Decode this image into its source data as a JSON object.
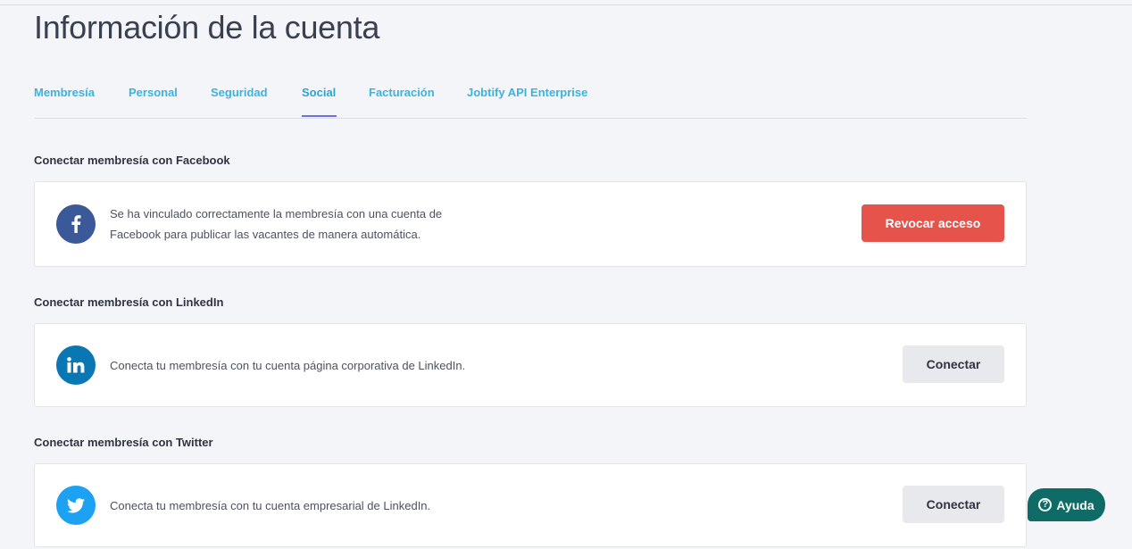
{
  "page": {
    "title": "Información de la cuenta"
  },
  "tabs": [
    {
      "label": "Membresía",
      "active": false
    },
    {
      "label": "Personal",
      "active": false
    },
    {
      "label": "Seguridad",
      "active": false
    },
    {
      "label": "Social",
      "active": true
    },
    {
      "label": "Facturación",
      "active": false
    },
    {
      "label": "Jobtify API Enterprise",
      "active": false
    }
  ],
  "sections": {
    "facebook": {
      "heading": "Conectar membresía con Facebook",
      "description_line1": "Se ha vinculado correctamente la membresía con una cuenta de",
      "description_line2": "Facebook para publicar las vacantes de manera automática.",
      "button_label": "Revocar acceso",
      "icon": "facebook-icon",
      "icon_color": "#3b5998"
    },
    "linkedin": {
      "heading": "Conectar membresía con LinkedIn",
      "description": "Conecta tu membresía con tu cuenta página corporativa de LinkedIn.",
      "button_label": "Conectar",
      "icon": "linkedin-icon",
      "icon_color": "#0a77b5"
    },
    "twitter": {
      "heading": "Conectar membresía con Twitter",
      "description": "Conecta tu membresía con tu cuenta empresarial de LinkedIn.",
      "button_label": "Conectar",
      "icon": "twitter-icon",
      "icon_color": "#1da1f2"
    }
  },
  "help": {
    "label": "Ayuda",
    "icon": "question-circle-icon",
    "glyph": "?"
  },
  "colors": {
    "accent_tab": "#3bb3dc",
    "tab_underline": "#6f6fe0",
    "danger": "#e5534b",
    "help_bg": "#0e6b66"
  }
}
